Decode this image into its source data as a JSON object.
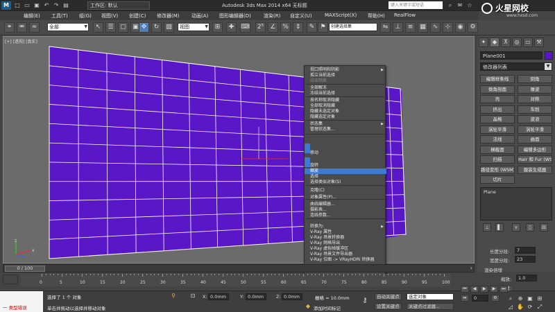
{
  "titlebar": {
    "workspace_label": "工作区: 默认",
    "window_title": "Autodesk 3ds Max  2014 x64      无标题",
    "search_placeholder": "键入关键字或短语"
  },
  "logo": {
    "name": "火星网校",
    "url": "www.hxsd.com"
  },
  "menubar": [
    "编辑(E)",
    "工具(T)",
    "组(G)",
    "视图(V)",
    "创建(C)",
    "修改器(M)",
    "动画(A)",
    "图形编辑器(D)",
    "渲染(R)",
    "自定义(U)",
    "MAXScript(X)",
    "帮助(H)",
    "RealFlow"
  ],
  "toolbar": {
    "filter_select": "全部",
    "coord_select": "视图",
    "selection_set": "创建选择集"
  },
  "viewport": {
    "label": "[+] [透视] [真实]",
    "plane_color": "#5a17c7",
    "grid_cols": 15,
    "grid_rows": 11
  },
  "quad_menu": {
    "items": [
      {
        "label": "视口照明和阴影",
        "state": "normal",
        "submenu": true
      },
      {
        "label": "孤立当前选择",
        "state": "normal"
      },
      {
        "label": "结束隔离",
        "state": "dim"
      },
      {
        "label": "全部解冻",
        "state": "normal"
      },
      {
        "label": "冻结当前选择",
        "state": "normal"
      },
      {
        "label": "按名称取消隐藏",
        "state": "normal"
      },
      {
        "label": "全部取消隐藏",
        "state": "normal"
      },
      {
        "label": "隐藏未选定对象",
        "state": "normal"
      },
      {
        "label": "隐藏选定对象",
        "state": "normal"
      },
      {
        "label": "状态集",
        "state": "normal",
        "submenu": true
      },
      {
        "label": "管理状态集...",
        "state": "normal"
      },
      {
        "label": "移动",
        "state": "normal"
      },
      {
        "label": "旋转",
        "state": "normal"
      },
      {
        "label": "缩放",
        "state": "highlight"
      },
      {
        "label": "选择",
        "state": "normal"
      },
      {
        "label": "选择类似对象(S)",
        "state": "normal"
      },
      {
        "label": "克隆(C)",
        "state": "normal"
      },
      {
        "label": "对象属性(P)...",
        "state": "normal"
      },
      {
        "label": "曲线编辑器...",
        "state": "normal"
      },
      {
        "label": "摄影表...",
        "state": "normal"
      },
      {
        "label": "连线参数...",
        "state": "normal"
      },
      {
        "label": "转换为:",
        "state": "normal",
        "submenu": true
      },
      {
        "label": "V-Ray 属性",
        "state": "normal"
      },
      {
        "label": "V-Ray 场景转换器",
        "state": "normal"
      },
      {
        "label": "V-Ray 网格导出",
        "state": "normal"
      },
      {
        "label": "V-Ray 虚拟帧缓冲区",
        "state": "normal"
      },
      {
        "label": "V-Ray 场景文件导出器",
        "state": "normal"
      },
      {
        "label": "V-Ray 位图 -> VRayHDRI 转换器",
        "state": "normal"
      }
    ]
  },
  "command_panel": {
    "object_name": "Plane001",
    "modifier_list": "修改器列表",
    "modifiers": [
      [
        "编辑样条线",
        "倒角"
      ],
      [
        "倒角剖面",
        "噪波"
      ],
      [
        "壳",
        "对称"
      ],
      [
        "挤出",
        "车削"
      ],
      [
        "晶格",
        "波浪"
      ],
      [
        "涡轮平滑",
        "涡轮平滑"
      ],
      [
        "法线",
        "曲面"
      ],
      [
        "横截面",
        "编辑多边形"
      ],
      [
        "扫描",
        "Hair 和 Fur (WSM)"
      ],
      [
        "路径变形 (WSM)",
        "服装生成器"
      ],
      [
        "切片",
        ""
      ]
    ],
    "stack_item": "Plane",
    "params": {
      "length_segs_label": "长度分段:",
      "length_segs": "7",
      "width_segs_label": "宽度分段:",
      "width_segs": "23",
      "render_mult_label": "渲染倍增",
      "scale_label": "缩放:",
      "scale": "1.0",
      "density_label": "密度:"
    }
  },
  "timeline": {
    "frame": "0 / 100",
    "ticks": [
      "0",
      "5",
      "10",
      "15",
      "20",
      "25",
      "30",
      "35",
      "40",
      "45",
      "50",
      "55",
      "60",
      "65",
      "70",
      "75",
      "80",
      "85",
      "90",
      "95",
      "100"
    ]
  },
  "status": {
    "maxscript_text": "一 类型错误",
    "line1": "选择了 1 个 对象",
    "line2": "单击并拖动以选择并移动对象",
    "x_label": "X:",
    "x_val": "0.0mm",
    "y_label": "Y:",
    "y_val": "0.0mm",
    "z_label": "Z:",
    "z_val": "0.0mm",
    "grid_label": "栅格 = 10.0mm",
    "add_time_tag": "添加时间标记",
    "auto_key": "自动关键点",
    "set_key": "设置关键点",
    "key_select": "选定对象",
    "key_filter": "关键点过滤器...",
    "frame_val": "0"
  }
}
